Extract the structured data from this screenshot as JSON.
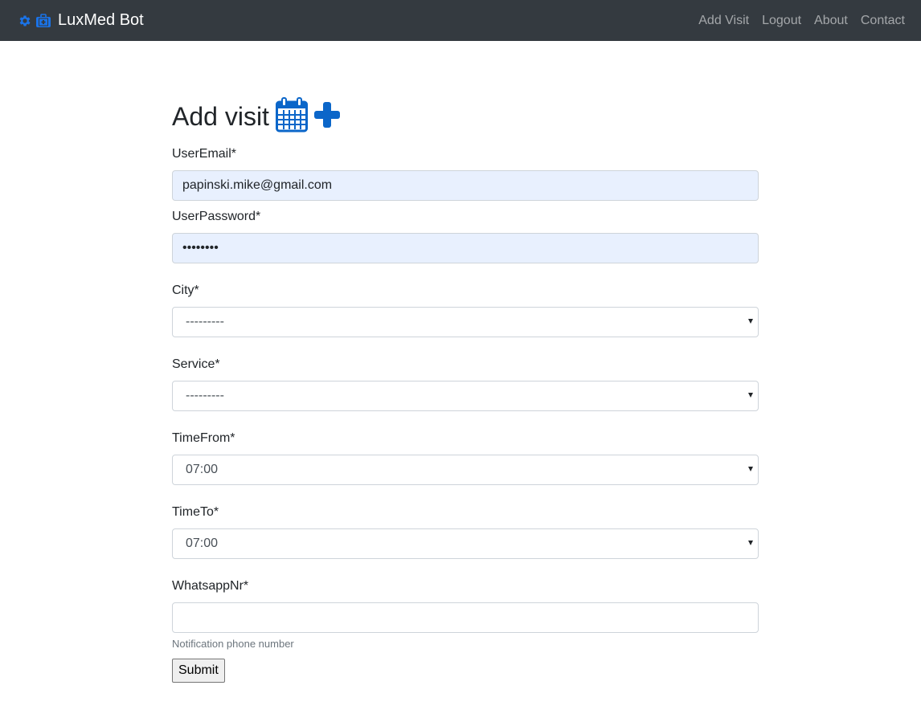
{
  "navbar": {
    "brand": "LuxMed Bot",
    "links": [
      "Add Visit",
      "Logout",
      "About",
      "Contact"
    ]
  },
  "page": {
    "title": "Add visit"
  },
  "form": {
    "email": {
      "label": "UserEmail*",
      "value": "papinski.mike@gmail.com"
    },
    "password": {
      "label": "UserPassword*",
      "value": "••••••••"
    },
    "city": {
      "label": "City*",
      "value": "---------"
    },
    "service": {
      "label": "Service*",
      "value": "---------"
    },
    "time_from": {
      "label": "TimeFrom*",
      "value": "07:00"
    },
    "time_to": {
      "label": "TimeTo*",
      "value": "07:00"
    },
    "whatsapp": {
      "label": "WhatsappNr*",
      "value": "",
      "help": "Notification phone number"
    },
    "submit_label": "Submit"
  },
  "colors": {
    "navbar_bg": "#343a40",
    "accent": "#0b66c9",
    "autofill_bg": "#e8f0fe"
  },
  "icons": [
    "gear-icon",
    "medkit-icon",
    "calendar-icon",
    "plus-icon"
  ]
}
